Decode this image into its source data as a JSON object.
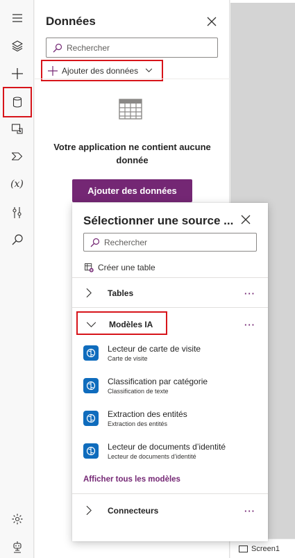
{
  "colors": {
    "accent": "#742774",
    "highlight": "#d7141a",
    "model_icon": "#0f6cbd"
  },
  "rail": {
    "icons": [
      "hamburger-menu-icon",
      "layers-icon",
      "plus-icon",
      "database-icon",
      "media-icon",
      "power-automate-icon",
      "variables-icon",
      "advanced-tools-icon",
      "search-icon",
      "settings-icon",
      "virtual-agent-icon"
    ],
    "variables_glyph": "(x)"
  },
  "panel": {
    "title": "Données",
    "search_placeholder": "Rechercher",
    "add_data_label": "Ajouter des données",
    "empty_text": "Votre application ne contient aucune donnée",
    "primary_button": "Ajouter des données"
  },
  "flyout": {
    "title": "Sélectionner une source ...",
    "search_placeholder": "Rechercher",
    "create_table": "Créer une table",
    "groups": {
      "tables": "Tables",
      "models": "Modèles IA",
      "connectors": "Connecteurs"
    },
    "more_glyph": "···",
    "models": [
      {
        "title": "Lecteur de carte de visite",
        "subtitle": "Carte de visite"
      },
      {
        "title": "Classification par catégorie",
        "subtitle": "Classification de texte"
      },
      {
        "title": "Extraction des entités",
        "subtitle": "Extraction des entités"
      },
      {
        "title": "Lecteur de documents d’identité",
        "subtitle": "Lecteur de documents d’identité"
      }
    ],
    "show_all": "Afficher tous les modèles"
  },
  "screen_tab": {
    "label": "Screen1"
  }
}
